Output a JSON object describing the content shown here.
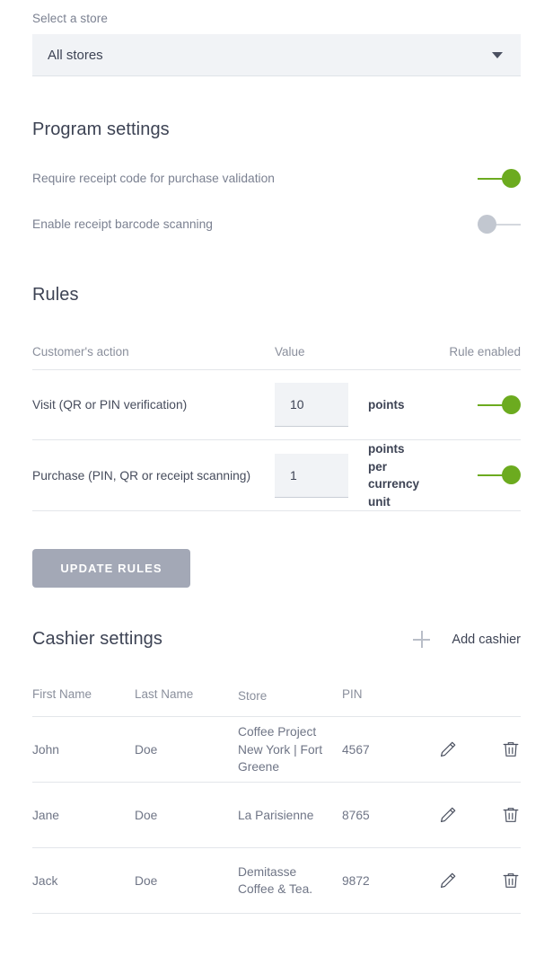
{
  "store_select": {
    "label": "Select a store",
    "value": "All stores",
    "caret_icon": "chevron-down-icon"
  },
  "program_settings": {
    "title": "Program settings",
    "toggles": [
      {
        "label": "Require receipt code for purchase validation",
        "state": "on"
      },
      {
        "label": "Enable receipt barcode scanning",
        "state": "off"
      }
    ]
  },
  "rules": {
    "title": "Rules",
    "columns": {
      "action": "Customer's action",
      "value": "Value",
      "enabled": "Rule enabled"
    },
    "rows": [
      {
        "action": "Visit (QR or PIN verification)",
        "value": "10",
        "unit": "points",
        "enabled": "on"
      },
      {
        "action": "Purchase (PIN, QR or receipt scanning)",
        "value": "1",
        "unit": "points per currency unit",
        "enabled": "on"
      }
    ],
    "update_button": "UPDATE RULES"
  },
  "cashier_settings": {
    "title": "Cashier settings",
    "add_label": "Add cashier",
    "add_icon": "plus-icon",
    "columns": {
      "first_name": "First Name",
      "last_name": "Last Name",
      "store": "Store",
      "pin": "PIN"
    },
    "rows": [
      {
        "first_name": "John",
        "last_name": "Doe",
        "store": "Coffee Project New York | Fort Greene",
        "pin": "4567"
      },
      {
        "first_name": "Jane",
        "last_name": "Doe",
        "store": "La Parisienne",
        "pin": "8765"
      },
      {
        "first_name": "Jack",
        "last_name": "Doe",
        "store": "Demitasse Coffee & Tea.",
        "pin": "9872"
      }
    ],
    "row_actions": {
      "edit_icon": "pencil-icon",
      "delete_icon": "trash-icon"
    }
  },
  "colors": {
    "accent_green": "#6cab1f",
    "toggle_off": "#c2c7d0",
    "button_gray": "#a3a8b6",
    "text_dark": "#3d4354",
    "text_muted": "#7b8191"
  }
}
